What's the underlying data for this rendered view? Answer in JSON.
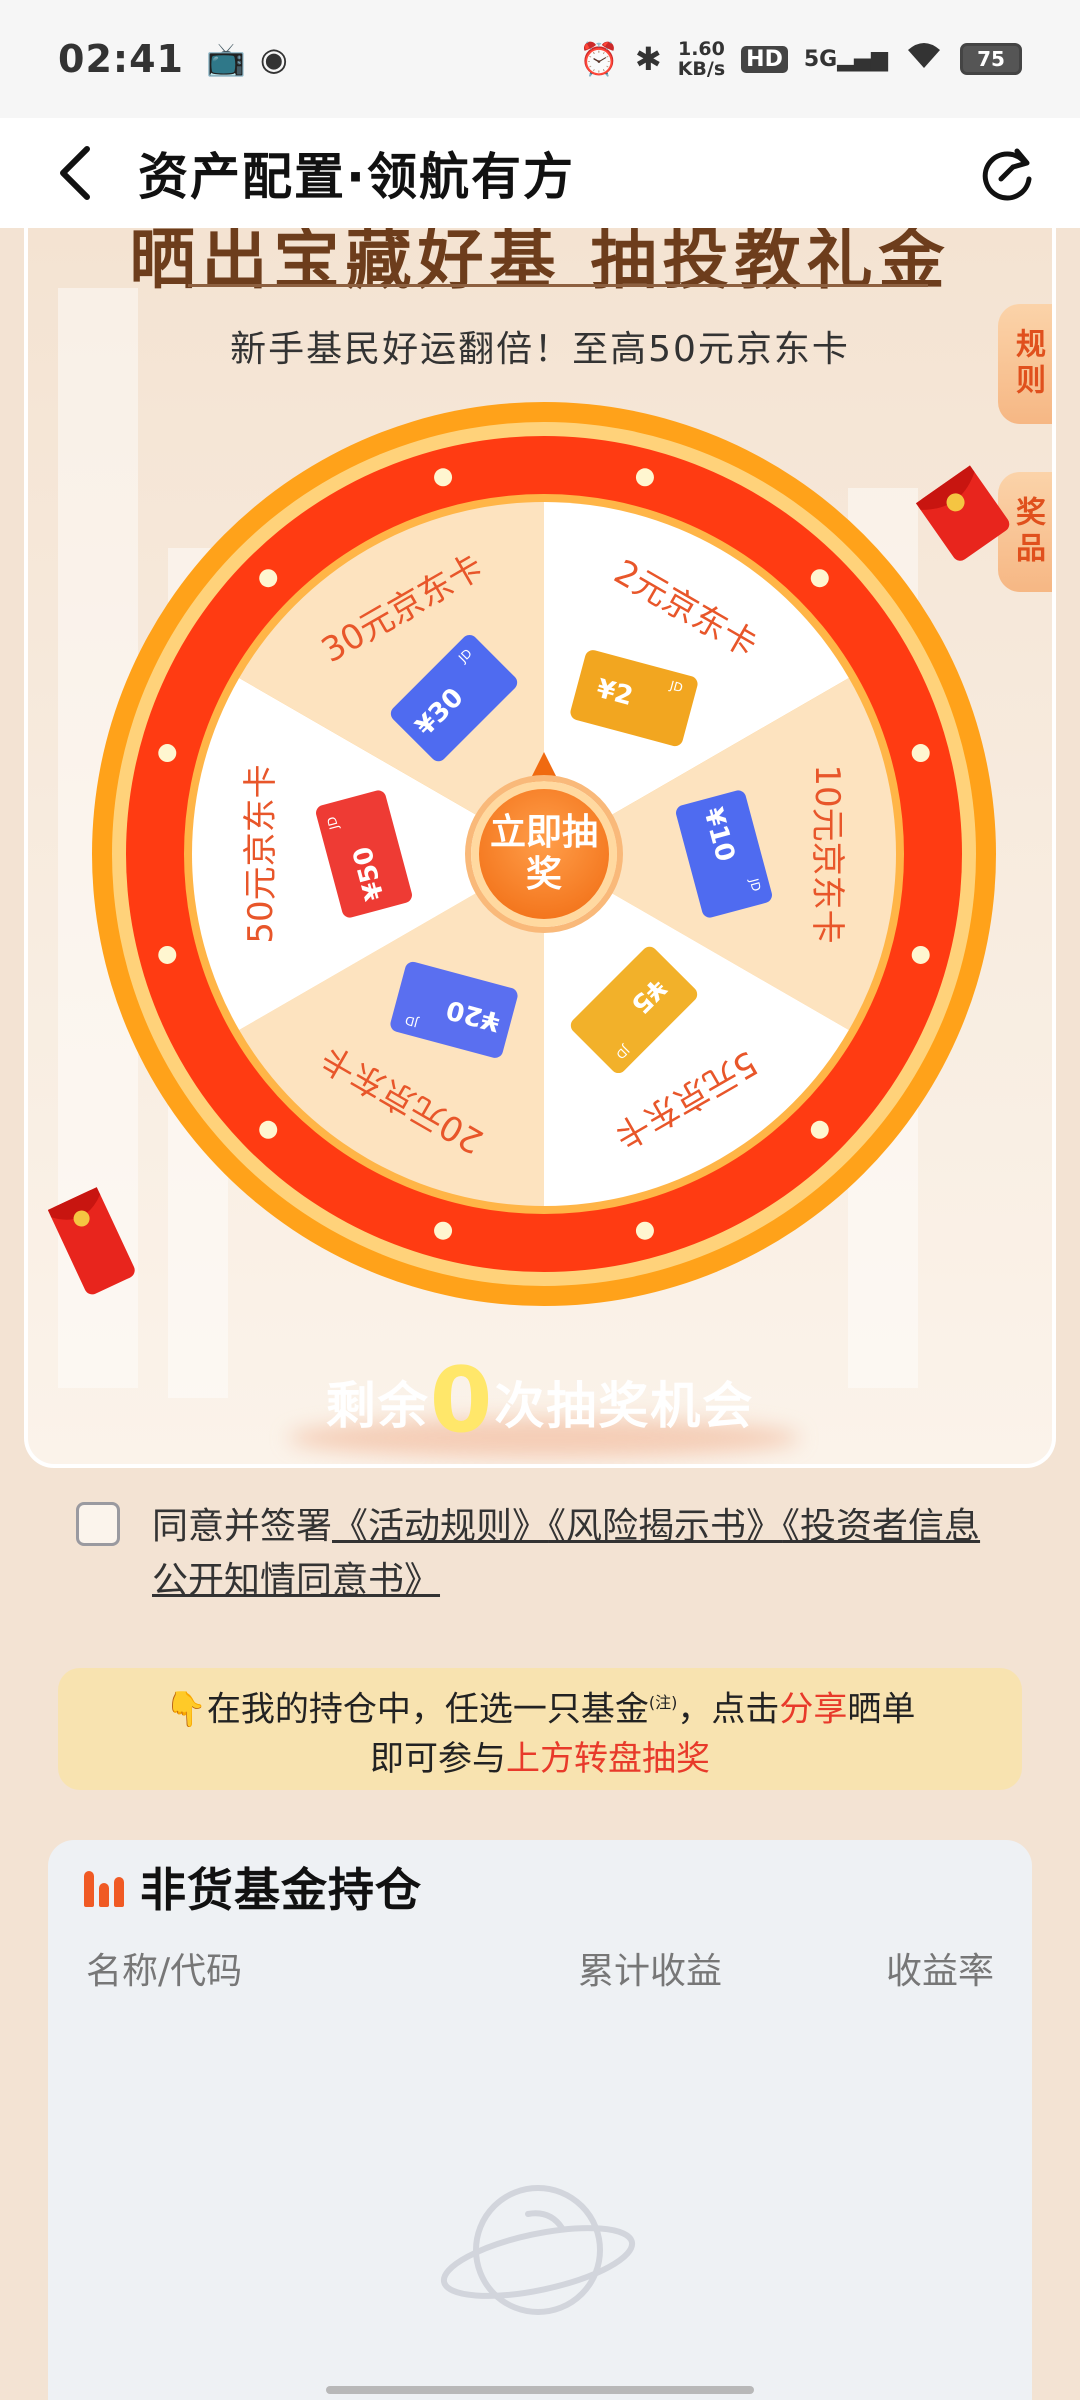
{
  "status_bar": {
    "time": "02:41",
    "net_speed_value": "1.60",
    "net_speed_unit": "KB/s",
    "hd": "HD",
    "network": "5G",
    "battery": "75"
  },
  "nav": {
    "title": "资产配置·领航有方"
  },
  "activity": {
    "title": "晒出宝藏好基 抽投教礼金",
    "subtitle": "新手基民好运翻倍！至高50元京东卡",
    "rules_tab": "规则",
    "prizes_tab": "奖品",
    "wheel_button": "立即抽奖",
    "prizes": [
      {
        "label": "2元京东卡",
        "card": "¥2"
      },
      {
        "label": "10元京东卡",
        "card": "¥10"
      },
      {
        "label": "5元京东卡",
        "card": "¥5"
      },
      {
        "label": "20元京东卡",
        "card": "¥20"
      },
      {
        "label": "50元京东卡",
        "card": "¥50"
      },
      {
        "label": "30元京东卡",
        "card": "¥30"
      }
    ],
    "card_brand": "JD",
    "remaining_prefix": "剩余",
    "remaining_count": "0",
    "remaining_suffix": "次抽奖机会",
    "colors": {
      "ring": "#ff3b12",
      "ring_outer": "#ffa21a",
      "segment_light": "#fde3bf",
      "segment_white": "#ffffff",
      "label": "#e8562a"
    }
  },
  "agreement": {
    "prefix": "同意并签署",
    "links": [
      "《活动规则》",
      "《风险揭示书》",
      "《投资者信息公开知情同意书》"
    ]
  },
  "tip": {
    "line1_a": "在我的持仓中，任选一只基金",
    "line1_note": "(注)",
    "line1_b": "，点击",
    "line1_share": "分享",
    "line1_c": "晒单",
    "line2_a": "即可参与",
    "line2_red": "上方转盘抽奖"
  },
  "holdings": {
    "title": "非货基金持仓",
    "columns": [
      "名称/代码",
      "累计收益",
      "收益率"
    ]
  }
}
